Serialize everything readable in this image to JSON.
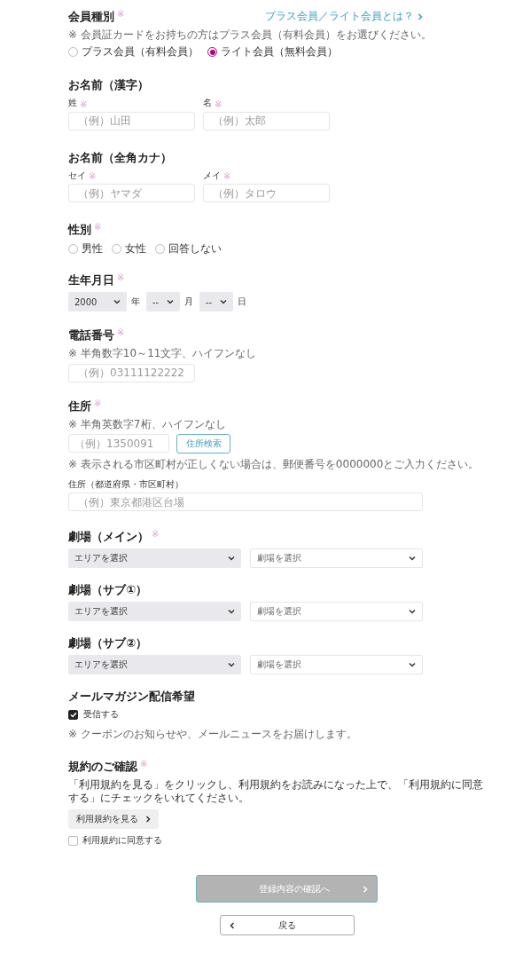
{
  "sections": [
    {
      "kind": "radio",
      "title": "会員種別",
      "required": "※",
      "link": "プラス会員／ライト会員とは？",
      "note": "※ 会員証カードをお持ちの方はプラス会員（有料会員）をお選びください。",
      "options": [
        {
          "label": "プラス会員（有料会員）",
          "selected": false
        },
        {
          "label": "ライト会員（無料会員）",
          "selected": true
        }
      ]
    },
    {
      "kind": "name",
      "title": "お名前（漢字）",
      "fields": [
        {
          "label": "姓",
          "required": "※",
          "placeholder": "（例）山田"
        },
        {
          "label": "名",
          "required": "※",
          "placeholder": "（例）太郎"
        }
      ]
    },
    {
      "kind": "name",
      "title": "お名前（全角カナ）",
      "fields": [
        {
          "label": "セイ",
          "required": "※",
          "placeholder": "（例）ヤマダ"
        },
        {
          "label": "メイ",
          "required": "※",
          "placeholder": "（例）タロウ"
        }
      ]
    },
    {
      "kind": "radio",
      "title": "性別",
      "required": "※",
      "options": [
        {
          "label": "男性",
          "selected": false
        },
        {
          "label": "女性",
          "selected": false
        },
        {
          "label": "回答しない",
          "selected": false
        }
      ]
    },
    {
      "kind": "date",
      "title": "生年月日",
      "required": "※",
      "selects": [
        {
          "value": "2000",
          "unit": "年"
        },
        {
          "value": "--",
          "unit": "月"
        },
        {
          "value": "--",
          "unit": "日"
        }
      ]
    },
    {
      "kind": "phone",
      "title": "電話番号",
      "required": "※",
      "note": "※ 半角数字10～11文字、ハイフンなし",
      "placeholder": "（例）03111122222"
    },
    {
      "kind": "address",
      "title": "住所",
      "required": "※",
      "note": "※ 半角英数字7桁、ハイフンなし",
      "placeholder": "（例）1350091",
      "button": "住所検索",
      "note2": "※ 表示される市区町村が正しくない場合は、郵便番号を0000000とご入力ください。",
      "sublabel": "住所（都道府県・市区町村）",
      "placeholder2": "（例）東京都港区台場"
    },
    {
      "kind": "theater",
      "title": "劇場（メイン）",
      "required": "※",
      "area": "エリアを選択",
      "theater": "劇場を選択"
    },
    {
      "kind": "theater",
      "title": "劇場（サブ①）",
      "area": "エリアを選択",
      "theater": "劇場を選択"
    },
    {
      "kind": "theater",
      "title": "劇場（サブ②）",
      "area": "エリアを選択",
      "theater": "劇場を選択"
    },
    {
      "kind": "mail",
      "title": "メールマガジン配信希望",
      "checkbox": {
        "label": "受信する",
        "checked": true
      },
      "note": "※ クーポンのお知らせや、メールニュースをお届けします。"
    },
    {
      "kind": "terms",
      "title": "規約のご確認",
      "required": "※",
      "text": "「利用規約を見る」をクリックし、利用規約をお読みになった上で、「利用規約に同意する」にチェックをいれてください。",
      "button": "利用規約を見る",
      "checkbox": {
        "label": "利用規約に同意する",
        "checked": false
      }
    }
  ],
  "submit": {
    "label": "登録内容の確認へ",
    "disabled": true
  },
  "back": {
    "label": "戻る"
  }
}
